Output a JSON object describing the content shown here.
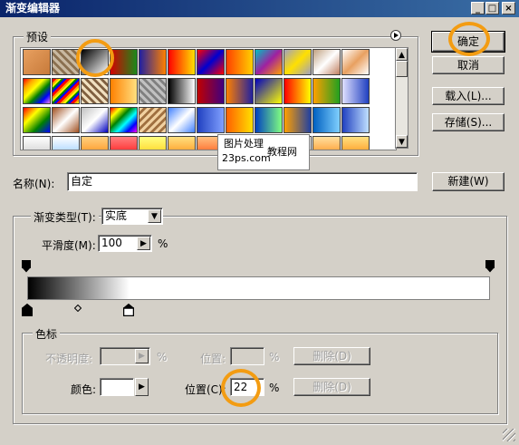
{
  "window": {
    "title": "渐变编辑器"
  },
  "titlebar_buttons": [
    "_",
    "□",
    "×"
  ],
  "presets": {
    "label": "预设",
    "menu_icon": "circle-right-arrow-icon",
    "swatches": [
      [
        "linear-gradient(135deg,#e8a060,#c77a3a)",
        "repeating-linear-gradient(45deg,#c8b8a0 0 3px,#8a7050 3px 6px)",
        "linear-gradient(135deg,#000,#fff)",
        "linear-gradient(90deg,#d40000,#1a8a1a)",
        "linear-gradient(90deg,#2020a0,#ff8000)",
        "linear-gradient(90deg,#ff0000,#ffe000)",
        "linear-gradient(135deg,#ff0000,#0000d0,#ff0000)",
        "linear-gradient(90deg,#ff4000,#ffd000)",
        "linear-gradient(135deg,#00c0c0,#a020a0,#ffa000)",
        "linear-gradient(135deg,#a0a0c0,#ffe000,#a0a0c0)",
        "linear-gradient(135deg,#c0a080,#fff,#c08060)",
        "linear-gradient(135deg,#fff,#e8a060,#fff)"
      ],
      [
        "linear-gradient(135deg,red,orange,yellow,green,blue,violet)",
        "repeating-linear-gradient(135deg,red 0 3px,orange 3px 5px,yellow 5px 7px,green 7px 9px,blue 9px 11px)",
        "repeating-linear-gradient(45deg,#f0e0c0 0 3px,#806040 3px 6px)",
        "linear-gradient(90deg,#ff8000,#ffe080)",
        "repeating-linear-gradient(45deg,#c0c0c0 0 3px,#808080 3px 6px)",
        "linear-gradient(90deg,#000,#fff)",
        "linear-gradient(90deg,#c00000,#400080)",
        "linear-gradient(90deg,#ff8000,#2020a0)",
        "linear-gradient(135deg,#0000c0,#ffff00)",
        "linear-gradient(90deg,#ff0000,#ff8000,#ffff00)",
        "linear-gradient(90deg,#ffa000,#20a020)",
        "linear-gradient(90deg,#e0e0ff,#2040c0)"
      ],
      [
        "linear-gradient(135deg,red,yellow,green,blue)",
        "linear-gradient(135deg,#a05020,#fff,#a05020)",
        "linear-gradient(135deg,#c0c0c0,#fff,#0000c0)",
        "linear-gradient(135deg,red,yellow,green,cyan,blue,magenta)",
        "repeating-linear-gradient(135deg,#f0d0a0 0 3px,#a07040 3px 6px)",
        "linear-gradient(135deg,#4080ff,#fff,#4080ff)",
        "linear-gradient(90deg,#2040c0,#80a0ff)",
        "linear-gradient(90deg,#ff6000,#ffe000)",
        "linear-gradient(90deg,#0040c0,#80ff80)",
        "linear-gradient(90deg,#ffa000,#2040a0)",
        "linear-gradient(90deg,#0060c0,#80d0ff)",
        "linear-gradient(90deg,#2040c0,#c0e0ff)"
      ],
      [
        "linear-gradient(180deg,#fff,#c0c0c0)",
        "linear-gradient(180deg,#fff,#80c0ff)",
        "linear-gradient(180deg,#ffd080,#ff8000)",
        "linear-gradient(180deg,#ff8080,#ff0000)",
        "linear-gradient(180deg,#ffff80,#ffc000)",
        "linear-gradient(180deg,#ffe080,#ff8000)",
        "linear-gradient(180deg,#ffc080,#ff4000)",
        "linear-gradient(180deg,#ffff80,#ff8000)",
        "linear-gradient(180deg,#fff,#c0c0c0)",
        "linear-gradient(180deg,#fff,#e0e0e0)",
        "linear-gradient(180deg,#ffe0a0,#ff8000)",
        "linear-gradient(180deg,#ffe080,#ff8000)"
      ]
    ]
  },
  "watermark": {
    "line1": "图片处理",
    "line2": "教程网",
    "line3": "23ps.com"
  },
  "buttons": {
    "ok": "确定",
    "cancel": "取消",
    "load": "载入(L)...",
    "save": "存储(S)...",
    "new": "新建(W)"
  },
  "name": {
    "label": "名称(N):",
    "value": "自定"
  },
  "gradient_type": {
    "label": "渐变类型(T):",
    "value": "实底"
  },
  "smoothness": {
    "label": "平滑度(M):",
    "value": "100",
    "unit": "%"
  },
  "gradient_bar": {
    "from": "#000000",
    "to": "#ffffff",
    "midpoint_percent": 11,
    "selected_stop_percent": 22
  },
  "color_stops": {
    "group_label": "色标",
    "opacity_label": "不透明度:",
    "opacity_value": "",
    "opacity_unit": "%",
    "opacity_location_label": "位置:",
    "opacity_location_value": "",
    "opacity_location_unit": "%",
    "opacity_delete": "删除(D)",
    "color_label": "颜色:",
    "color_value": "#ffffff",
    "location_label": "位置(C):",
    "location_value": "22",
    "location_unit": "%",
    "color_delete": "删除(D)"
  }
}
